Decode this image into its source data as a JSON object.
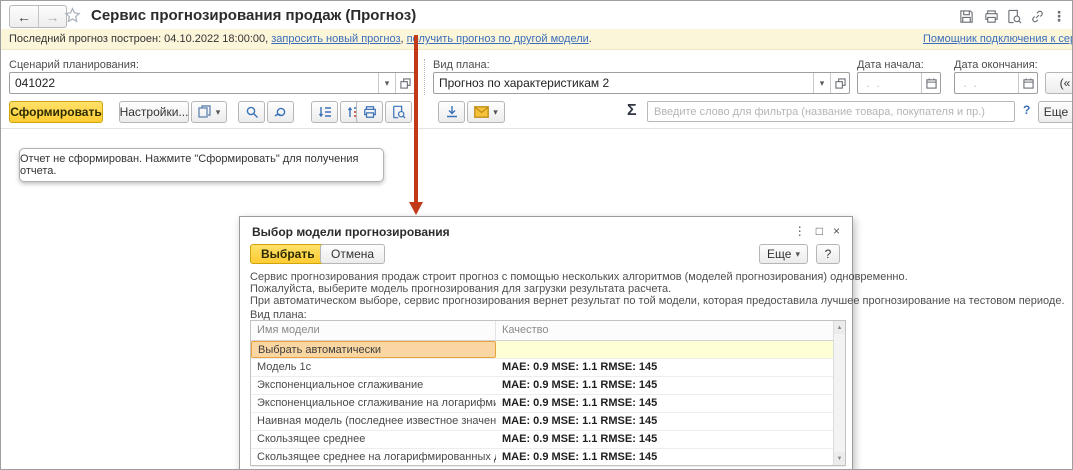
{
  "titlebar": {
    "title": "Сервис прогнозирования продаж (Прогноз)"
  },
  "glyphs": {
    "back": "←",
    "forward": "→",
    "dropdown": "▾",
    "more_dots": "⋮",
    "maximize": "□",
    "close": "×",
    "sigma": "Σ",
    "scroll_up": "▲",
    "scroll_down": "▼"
  },
  "infobar": {
    "prefix": "Последний прогноз построен: 04.10.2022 18:00:00,",
    "link_new_forecast": "запросить новый прогноз",
    "separator": ",",
    "link_other_model": "получить прогноз по другой модели",
    "period": ".",
    "service_link": "Помощник подключения к сервису"
  },
  "fields": {
    "scenario_label": "Сценарий планирования:",
    "scenario_value": "041022",
    "plan_label": "Вид плана:",
    "plan_value": "Прогноз по характеристикам 2",
    "date_start_label": "Дата начала:",
    "date_start_placeholder": " .  . ",
    "date_end_label": "Дата окончания:",
    "date_end_placeholder": " .  . ",
    "collapse_button": "(«"
  },
  "toolbar": {
    "generate_label": "Сформировать",
    "settings_label": "Настройки...",
    "filter_placeholder": "Введите слово для фильтра (название товара, покупателя и пр.)",
    "help_label": "?",
    "more_label": "Еще"
  },
  "report_message": "Отчет не сформирован. Нажмите \"Сформировать\" для получения отчета.",
  "dialog": {
    "title": "Выбор модели прогнозирования",
    "select_label": "Выбрать",
    "cancel_label": "Отмена",
    "more_label": "Еще",
    "help_label": "?",
    "description_line1": "Сервис прогнозирования продаж строит прогноз с помощью нескольких алгоритмов (моделей прогнозирования) одновременно.",
    "description_line2": "Пожалуйста, выберите модель прогнозирования для загрузки результата расчета.",
    "description_line3": "При автоматическом выборе, сервис прогнозирования вернет результат по той модели, которая предоставила лучшее прогнозирование на тестовом периоде.",
    "plan_kind_label": "Вид плана:",
    "table": {
      "header_name": "Имя модели",
      "header_quality": "Качество",
      "rows": [
        {
          "name": "Выбрать автоматически",
          "quality": ""
        },
        {
          "name": "Модель 1с",
          "quality": "MAE: 0.9 MSE: 1.1 RMSE: 145"
        },
        {
          "name": "Экспоненциальное сглаживание",
          "quality": "MAE: 0.9 MSE: 1.1 RMSE: 145"
        },
        {
          "name": "Экспоненциальное сглаживание на логарифмированных данных",
          "quality": "MAE: 0.9 MSE: 1.1 RMSE: 145"
        },
        {
          "name": "Наивная модель (последнее известное значение продаж)",
          "quality": "MAE: 0.9 MSE: 1.1 RMSE: 145"
        },
        {
          "name": "Скользящее среднее",
          "quality": "MAE: 0.9 MSE: 1.1 RMSE: 145"
        },
        {
          "name": "Скользящее среднее на логарифмированных данных",
          "quality": "MAE: 0.9 MSE: 1.1 RMSE: 145"
        }
      ]
    }
  },
  "colors": {
    "accent_yellow": "#ffd633",
    "info_bar_bg": "#fbf5da",
    "link_blue": "#3b6dba",
    "selected_orange": "#fad7a2",
    "selected_yellow": "#ffffd6",
    "arrow_red": "#c13a17"
  }
}
